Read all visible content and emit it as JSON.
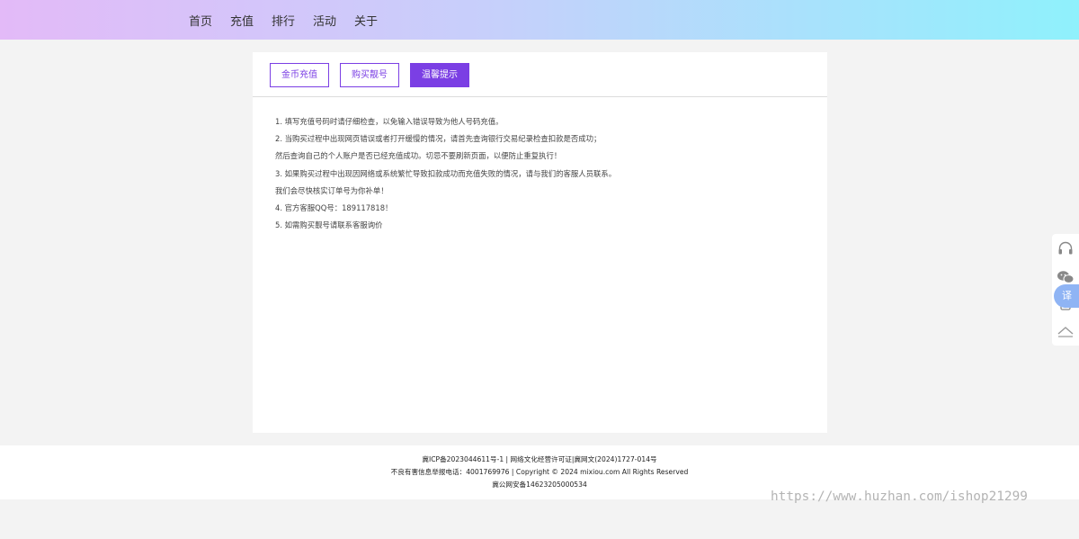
{
  "nav": {
    "items": [
      {
        "label": "首页"
      },
      {
        "label": "充值"
      },
      {
        "label": "排行"
      },
      {
        "label": "活动"
      },
      {
        "label": "关于"
      }
    ]
  },
  "tabs": [
    {
      "label": "金币充值"
    },
    {
      "label": "购买靓号"
    },
    {
      "label": "温馨提示",
      "active": true
    }
  ],
  "notes": [
    "1. 填写充值号码时请仔细检查，以免输入错误导致为他人号码充值。",
    "2. 当购买过程中出现网页错误或者打开缓慢的情况，请首先查询银行交易纪录检查扣款是否成功；",
    "然后查询自己的个人账户是否已经充值成功。切忌不要刷新页面，以便防止重复执行！",
    "3. 如果购买过程中出现因网络或系统繁忙导致扣款成功而充值失败的情况，请与我们的客服人员联系。",
    "我们会尽快核实订单号为你补单！",
    "4. 官方客服QQ号：189117818！",
    "5. 如需购买靓号请联系客服询价"
  ],
  "footer": {
    "line1": "冀ICP备2023044611号-1 | 网络文化经营许可证|冀网文(2024)1727-014号",
    "line2": "不良有害信息举报电话：4001769976 | Copyright © 2024 mixiou.com All Rights Reserved",
    "line3": "冀公网安备14623205000534"
  },
  "sidebar": {
    "icons": [
      "headset-icon",
      "wechat-icon",
      "phone-icon",
      "back-to-top-icon"
    ],
    "translate_label": "译"
  },
  "watermark": "https://www.huzhan.com/ishop21299",
  "colors": {
    "accent": "#7b3fe4",
    "header_gradient_start": "#e3baf8",
    "header_gradient_end": "#8ff1fc",
    "translate_badge": "#8fb4f4"
  }
}
